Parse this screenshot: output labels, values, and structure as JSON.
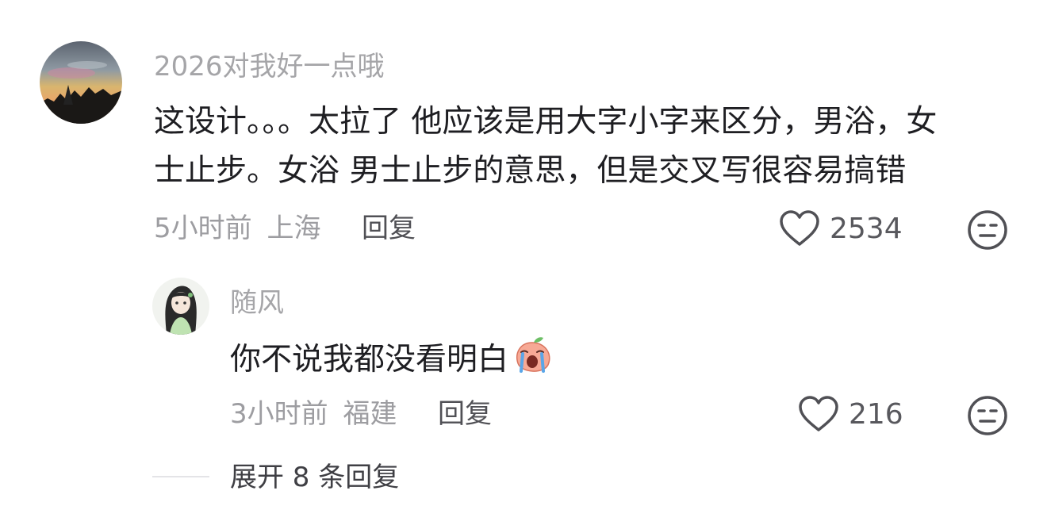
{
  "comment": {
    "username": "2026对我好一点哦",
    "text_line1": "这设计。。。太拉了 他应该是用大字小字来区分，男浴，女",
    "text_line2": "士止步。女浴 男士止步的意思，但是交叉写很容易搞错",
    "time": "5小时前",
    "location": "上海",
    "reply_label": "回复",
    "like_count": "2534",
    "avatar_icon": "sunset-landscape-avatar",
    "like_icon": "heart-outline-icon",
    "dislike_icon": "meh-face-icon"
  },
  "reply": {
    "username": "随风",
    "text": "你不说我都没看明白",
    "emoji": "crying-peach-emoji",
    "time": "3小时前",
    "location": "福建",
    "reply_label": "回复",
    "like_count": "216",
    "avatar_icon": "anime-girl-avatar"
  },
  "expand": {
    "label": "展开 8 条回复"
  }
}
